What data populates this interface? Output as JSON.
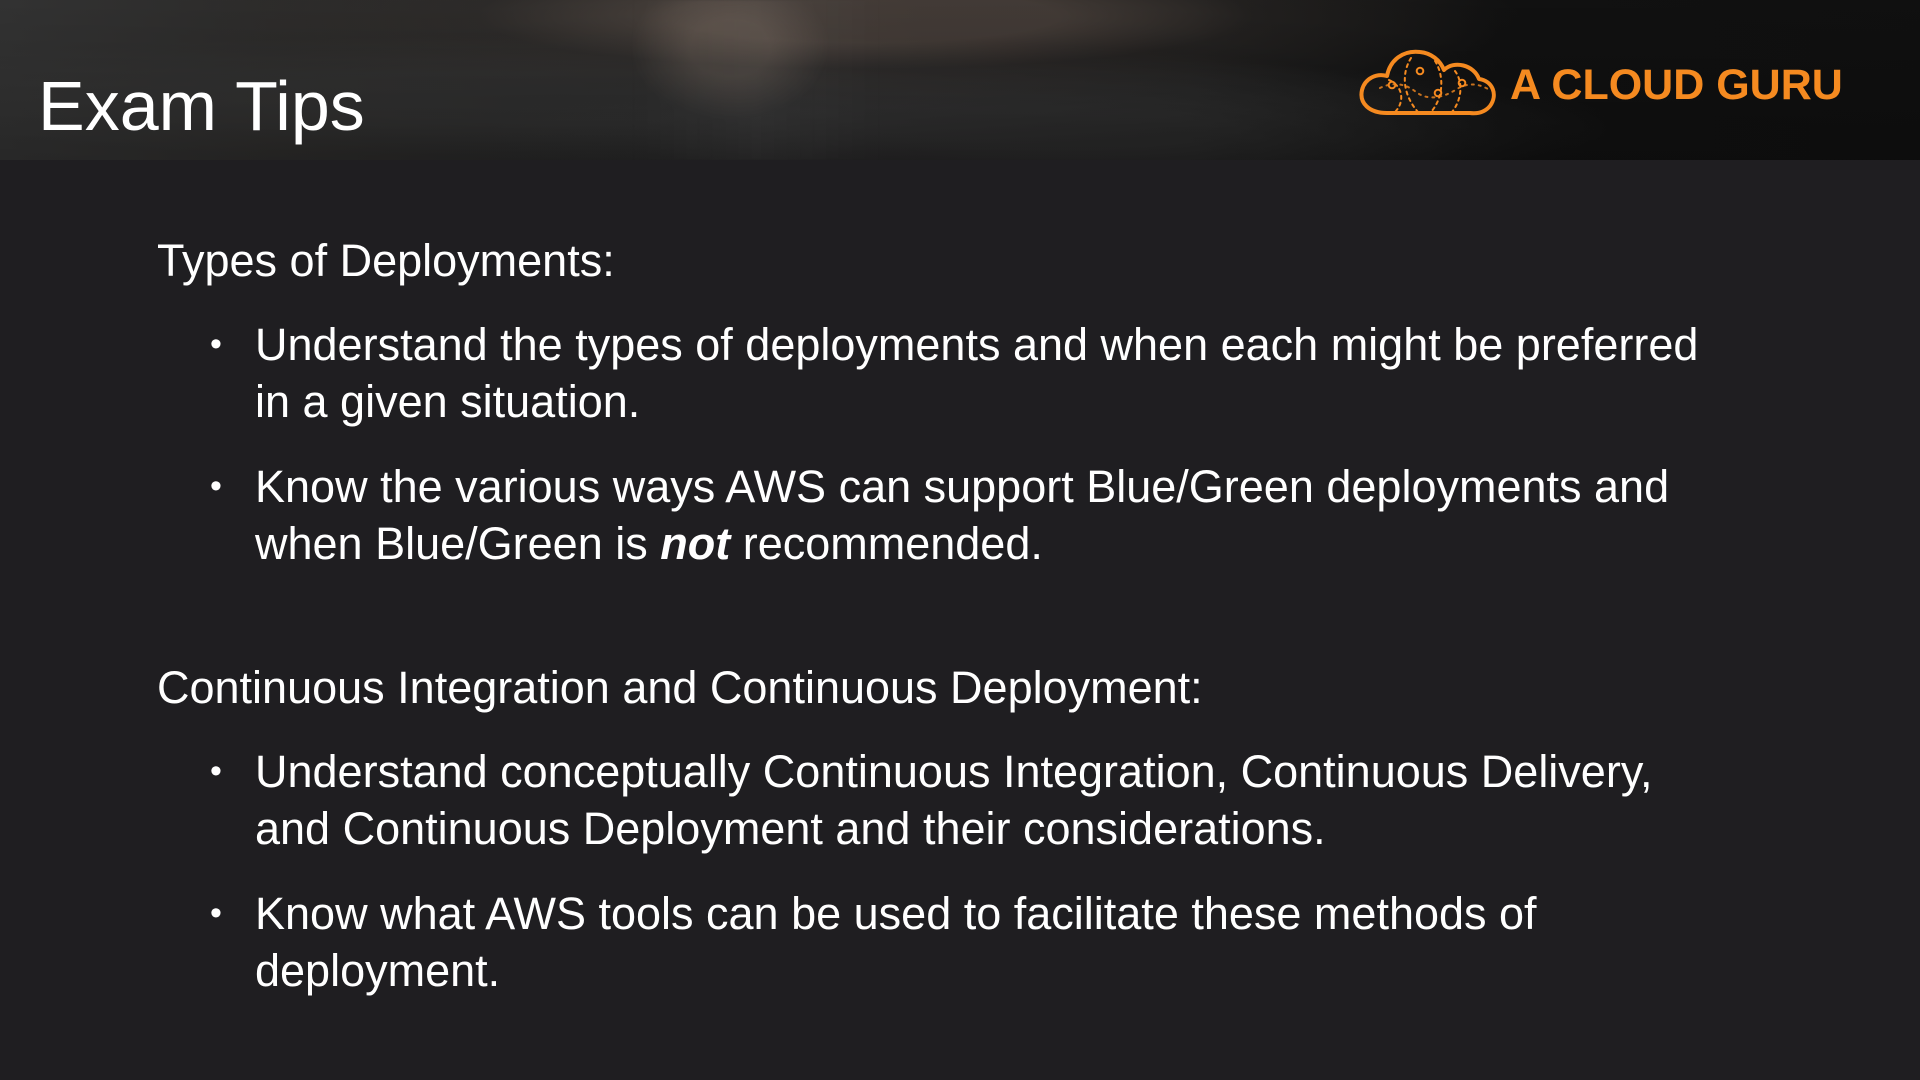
{
  "slide": {
    "title": "Exam Tips",
    "brand": {
      "name": "A CLOUD GURU",
      "icon": "cloud-logo-icon",
      "color": "#F58A20"
    },
    "colors": {
      "background": "#1F1E21",
      "text": "#FFFFFF",
      "accent": "#F58A20"
    }
  },
  "sections": [
    {
      "heading": "Types of Deployments:",
      "bullets": [
        {
          "marker": "•",
          "line1": "Understand the types of deployments and when each might be preferred",
          "line2": "in a given situation."
        },
        {
          "marker": "•",
          "line1": "Know the various ways AWS can support Blue/Green deployments and",
          "line2_before": "when Blue/Green is ",
          "line2_emphasis": "not",
          "line2_after": " recommended."
        }
      ]
    },
    {
      "heading": "Continuous Integration and Continuous Deployment:",
      "bullets": [
        {
          "marker": "•",
          "line1": "Understand conceptually Continuous Integration, Continuous Delivery,",
          "line2": "and Continuous Deployment and their considerations."
        },
        {
          "marker": "•",
          "line1": "Know what AWS tools can be used to facilitate these methods of",
          "line2": "deployment."
        }
      ]
    }
  ]
}
